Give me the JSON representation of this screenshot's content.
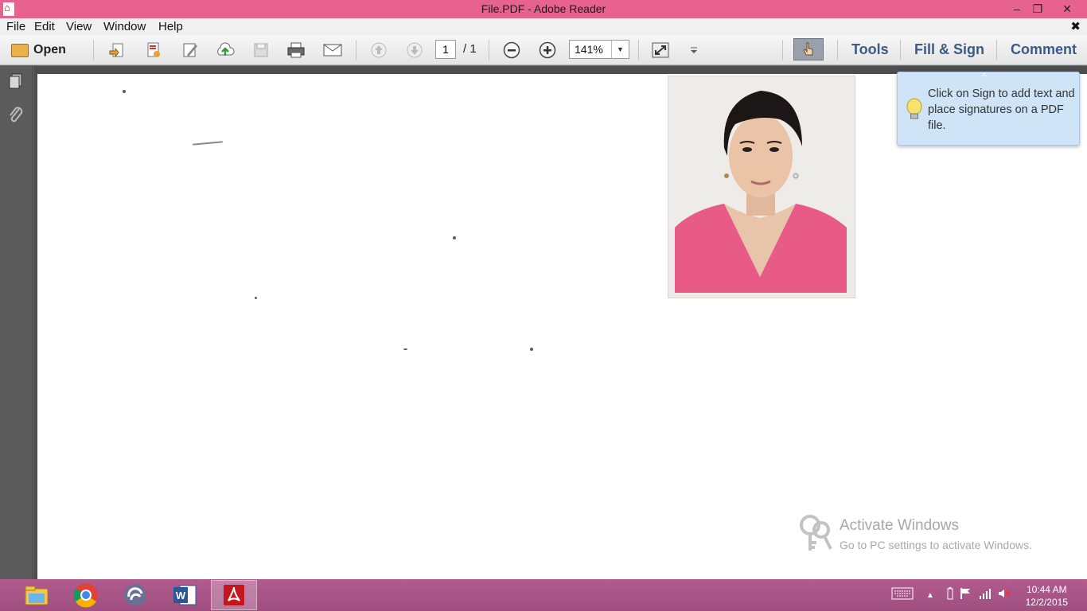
{
  "window": {
    "title": "File.PDF - Adobe Reader",
    "minimize_glyph": "–",
    "restore_glyph": "❐",
    "close_glyph": "✕"
  },
  "menu": {
    "items": [
      "File",
      "Edit",
      "View",
      "Window",
      "Help"
    ],
    "close_glyph": "✖"
  },
  "toolbar": {
    "open_label": "Open",
    "current_page": "1",
    "page_total": "/ 1",
    "zoom": "141%",
    "tools_label": "Tools",
    "fill_sign_label": "Fill & Sign",
    "comment_label": "Comment"
  },
  "tooltip": {
    "text": "Click on Sign to add text and place signatures on a PDF file."
  },
  "watermark": {
    "heading": "Activate Windows",
    "subtext": "Go to PC settings to activate Windows."
  },
  "taskbar": {
    "apps": [
      "file-explorer",
      "chrome",
      "bittorrent",
      "word",
      "adobe-reader"
    ],
    "time": "10:44 AM",
    "date": "12/2/2015"
  },
  "colors": {
    "titlebar": "#e8628f",
    "taskbar": "#a65284",
    "accent_link": "#3c5a84",
    "tooltip_bg": "#cfe4f7",
    "shirt": "#e85b86"
  }
}
